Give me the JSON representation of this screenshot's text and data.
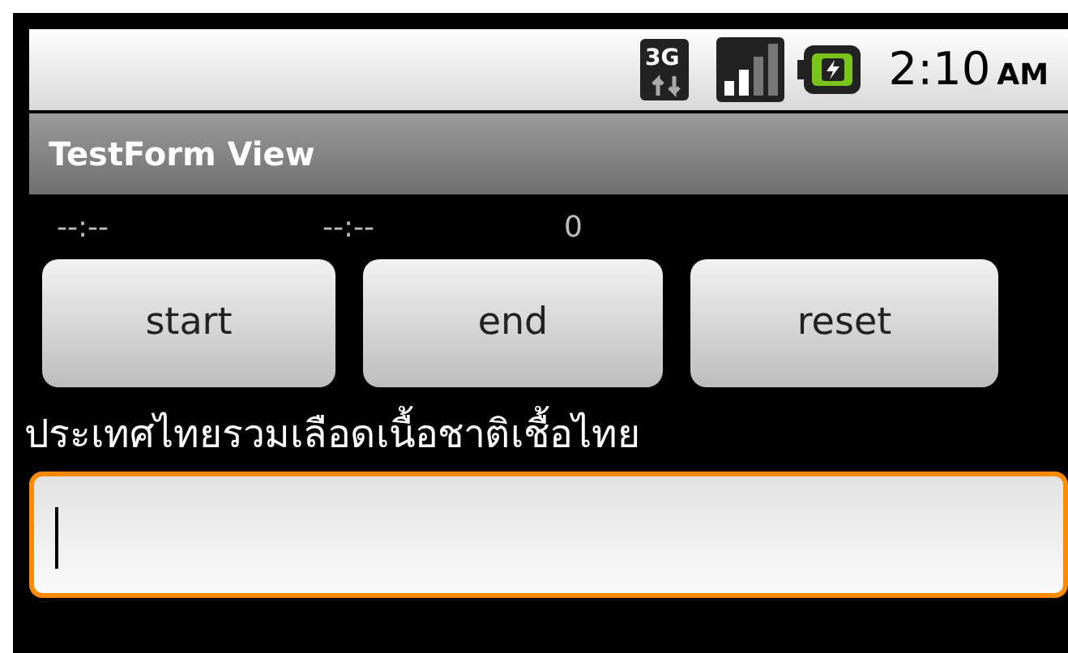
{
  "status_bar": {
    "network": "3G",
    "time": "2:10",
    "ampm": "AM"
  },
  "title_bar": {
    "title": "TestForm View"
  },
  "readouts": [
    "--:--",
    "--:--",
    "0"
  ],
  "buttons": [
    "start",
    "end",
    "reset"
  ],
  "label": "ประเทศไทยรวมเลือดเนื้อชาติเชื้อไทย",
  "input": {
    "focused": true
  }
}
